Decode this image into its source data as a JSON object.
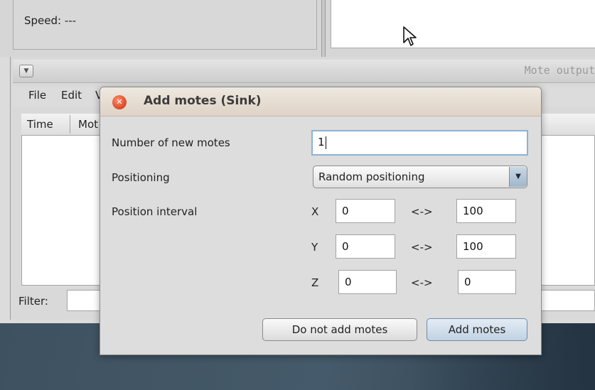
{
  "background": {
    "speed_label": "Speed: ---",
    "output_panel_title": "Mote output",
    "menu": [
      "File",
      "Edit",
      "V"
    ],
    "table_columns": [
      "Time",
      "Mot"
    ],
    "filter_label": "Filter:"
  },
  "dialog": {
    "title": "Add motes (Sink)",
    "number_label": "Number of new motes",
    "number_value": "1",
    "positioning_label": "Positioning",
    "positioning_value": "Random positioning",
    "interval_label": "Position interval",
    "axes": [
      {
        "axis": "X",
        "from": "0",
        "sep": "<->",
        "to": "100"
      },
      {
        "axis": "Y",
        "from": "0",
        "sep": "<->",
        "to": "100"
      },
      {
        "axis": "Z",
        "from": "0",
        "sep": "<->",
        "to": "0"
      }
    ],
    "cancel_label": "Do not add motes",
    "confirm_label": "Add motes"
  },
  "colors": {
    "dialog_title_bar": "#e6ddd2",
    "close_button": "#e0502e",
    "focus_border": "#8db2d2",
    "desktop": "#3e5160"
  },
  "icons": {
    "collapse": "collapse-arrow-icon",
    "close": "close-icon",
    "dropdown": "chevron-down-icon",
    "pointer": "mouse-pointer-icon"
  }
}
